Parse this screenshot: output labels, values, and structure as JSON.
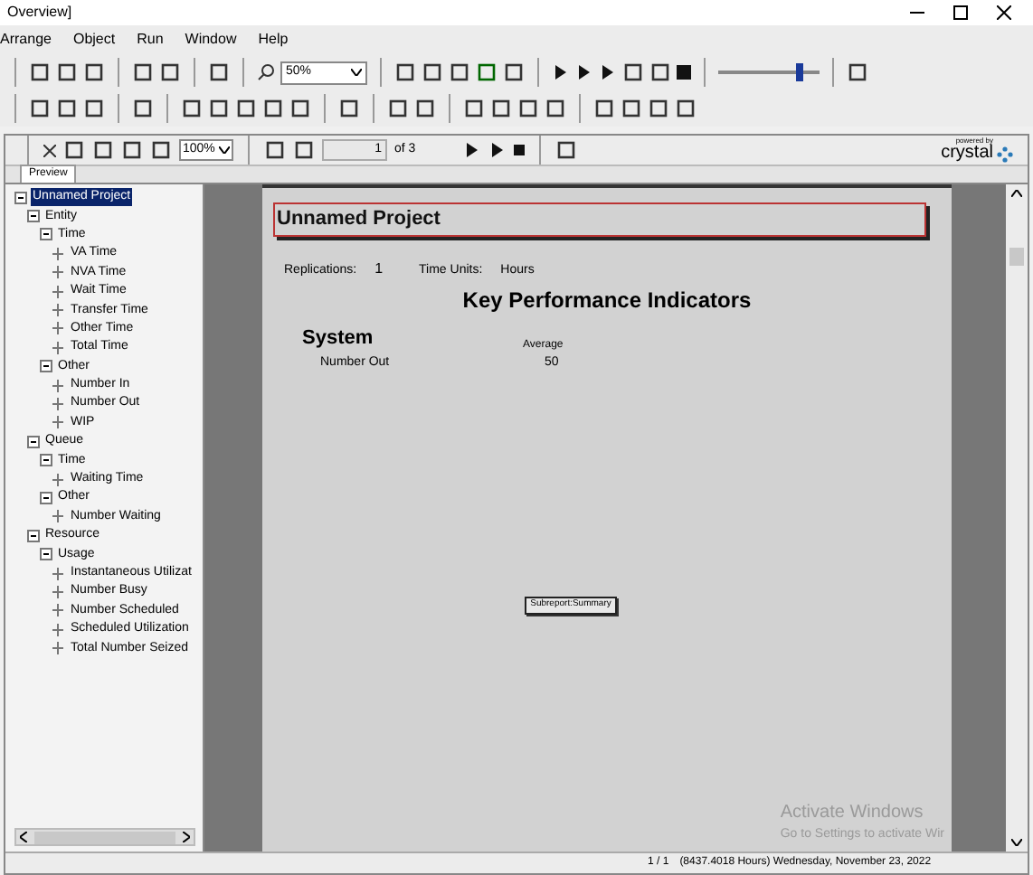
{
  "window": {
    "title": "Overview]"
  },
  "menu": [
    "Arrange",
    "Object",
    "Run",
    "Window",
    "Help"
  ],
  "toolbar": {
    "zoom": "50%",
    "speed_slider": {
      "level": 0.8
    }
  },
  "viewer_toolbar": {
    "zoom": "100%",
    "page": "1",
    "page_count": "of 3",
    "brand": "crystal",
    "brand_caption": "powered by"
  },
  "tabs": [
    {
      "label": "Preview",
      "selected": true
    }
  ],
  "tree": [
    {
      "label": "Unnamed Project",
      "selected": true,
      "children": [
        {
          "label": "Entity",
          "selected": false,
          "children": [
            {
              "label": "Time",
              "selected": false,
              "children": [
                {
                  "label": "VA Time",
                  "selected": false
                },
                {
                  "label": "NVA Time",
                  "selected": false
                },
                {
                  "label": "Wait Time",
                  "selected": false
                },
                {
                  "label": "Transfer Time",
                  "selected": false
                },
                {
                  "label": "Other Time",
                  "selected": false
                },
                {
                  "label": "Total Time",
                  "selected": false
                }
              ]
            },
            {
              "label": "Other",
              "selected": false,
              "children": [
                {
                  "label": "Number In",
                  "selected": false
                },
                {
                  "label": "Number Out",
                  "selected": false
                },
                {
                  "label": "WIP",
                  "selected": false
                }
              ]
            }
          ]
        },
        {
          "label": "Queue",
          "selected": false,
          "children": [
            {
              "label": "Time",
              "selected": false,
              "children": [
                {
                  "label": "Waiting Time",
                  "selected": false
                }
              ]
            },
            {
              "label": "Other",
              "selected": false,
              "children": [
                {
                  "label": "Number Waiting",
                  "selected": false
                }
              ]
            }
          ]
        },
        {
          "label": "Resource",
          "selected": false,
          "children": [
            {
              "label": "Usage",
              "selected": false,
              "children": [
                {
                  "label": "Instantaneous Utilizat",
                  "selected": false
                },
                {
                  "label": "Number Busy",
                  "selected": false
                },
                {
                  "label": "Number Scheduled",
                  "selected": false
                },
                {
                  "label": "Scheduled Utilization",
                  "selected": false
                },
                {
                  "label": "Total Number Seized",
                  "selected": false
                }
              ]
            }
          ]
        }
      ]
    }
  ],
  "report": {
    "title": "Unnamed Project",
    "replications_label": "Replications:",
    "replications": "1",
    "time_units_label": "Time Units:",
    "time_units": "Hours",
    "heading": "Key Performance Indicators",
    "section": "System",
    "column": "Average",
    "rows": [
      {
        "label": "Number Out",
        "value": "50"
      }
    ],
    "subreport": "Subreport:Summary"
  },
  "overlay": {
    "title": "Activate Windows",
    "text": "Go to Settings to activate Wir"
  },
  "status_bar": {
    "pages": "1 / 1",
    "info": "(8437.4018 Hours) Wednesday, November 23, 2022"
  }
}
